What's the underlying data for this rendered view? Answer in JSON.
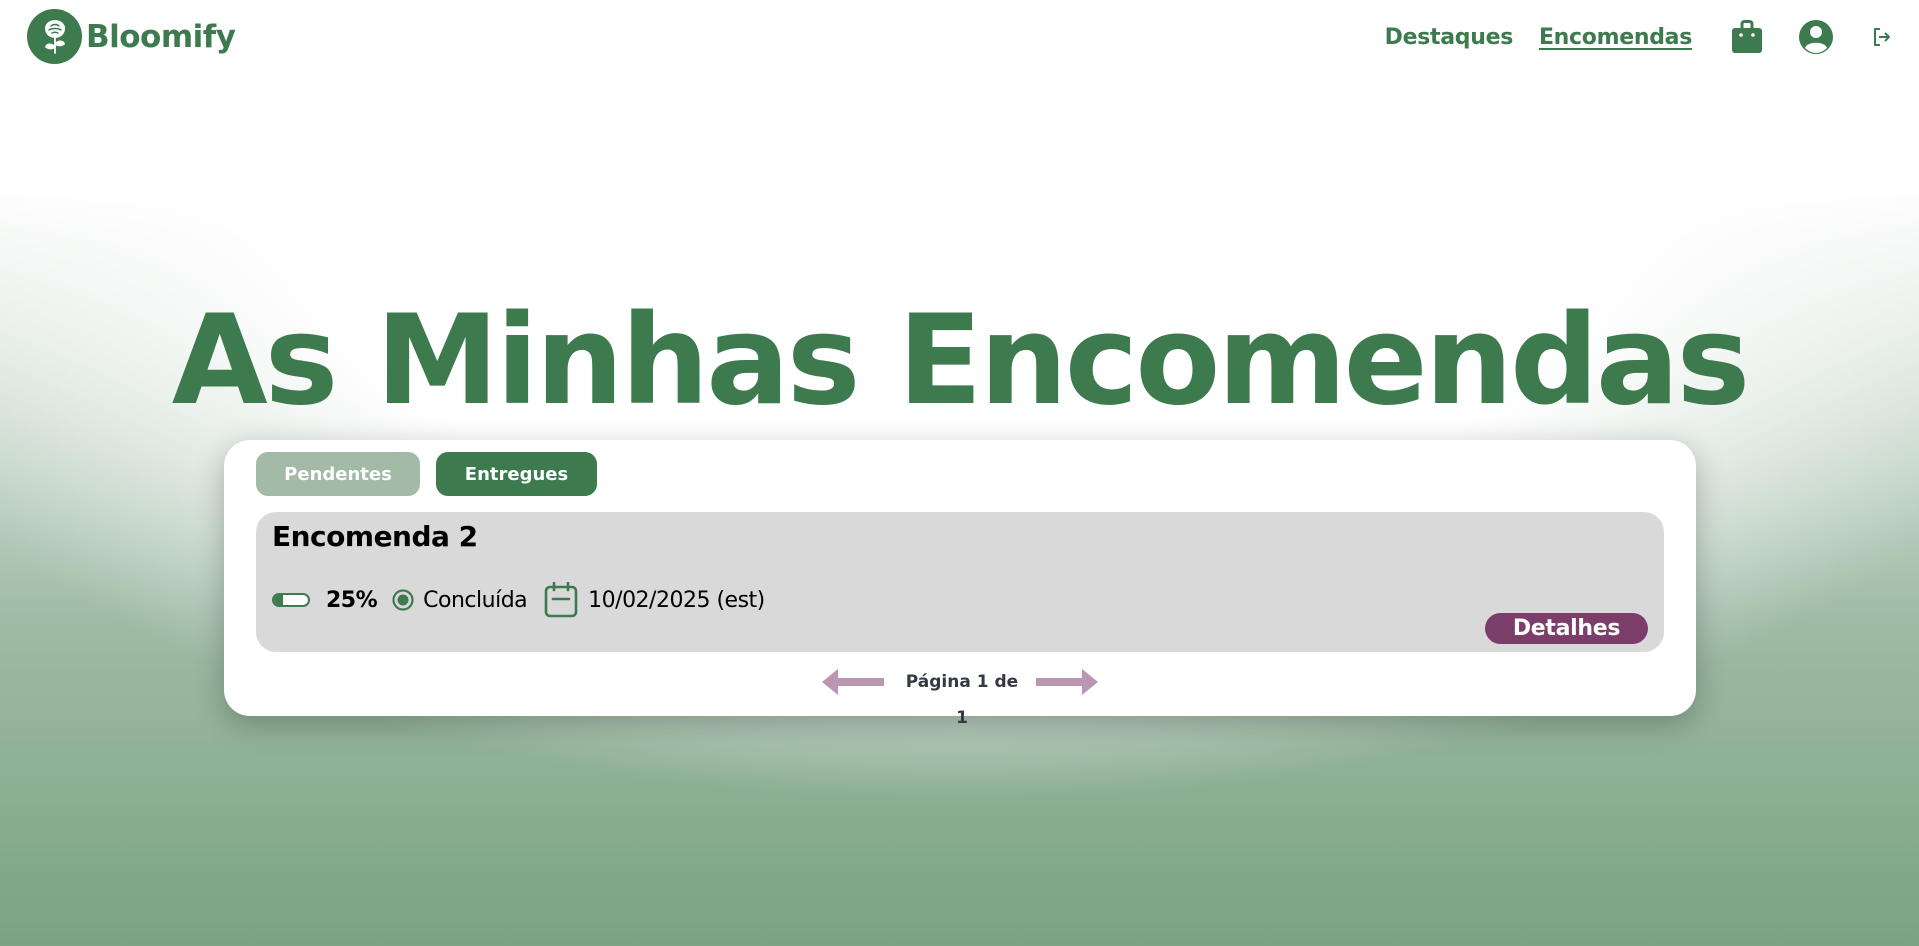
{
  "brand": {
    "name": "Bloomify",
    "logo_icon": "rose-icon"
  },
  "nav": {
    "destaques": "Destaques",
    "encomendas": "Encomendas",
    "active": "Encomendas",
    "icons": [
      "shopping-bag-icon",
      "user-account-icon",
      "logout-icon"
    ]
  },
  "page": {
    "title": "As Minhas Encomendas"
  },
  "tabs": {
    "pendentes": "Pendentes",
    "entregues": "Entregues",
    "active": "Entregues"
  },
  "order": {
    "title": "Encomenda 2",
    "progress_value": 0.25,
    "progress_text": "25%",
    "status": "Concluída",
    "date": "10/02/2025 (est)",
    "details_label": "Detalhes"
  },
  "pagination": {
    "label": "Página 1 de 1"
  },
  "colors": {
    "brand_green": "#3d7a4e",
    "inactive_tab": "#a2baa6",
    "details_button": "#7b3e6b",
    "arrow": "#bb96b3",
    "order_card": "#d9d9d9"
  }
}
